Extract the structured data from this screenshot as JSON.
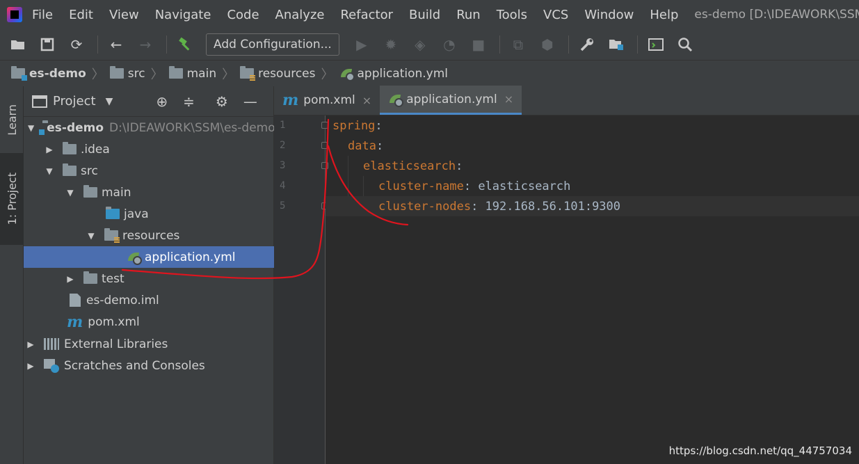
{
  "menu": {
    "items": [
      "File",
      "Edit",
      "View",
      "Navigate",
      "Code",
      "Analyze",
      "Refactor",
      "Build",
      "Run",
      "Tools",
      "VCS",
      "Window",
      "Help"
    ],
    "window_title": "es-demo [D:\\IDEAWORK\\SSM\\es-demo]"
  },
  "toolbar": {
    "config_label": "Add Configuration..."
  },
  "breadcrumb": [
    "es-demo",
    "src",
    "main",
    "resources",
    "application.yml"
  ],
  "toolstrip": {
    "learn": "Learn",
    "project": "1: Project"
  },
  "project_panel": {
    "title": "Project",
    "tree": [
      {
        "label": "es-demo",
        "hint": "D:\\IDEAWORK\\SSM\\es-demo"
      },
      {
        "label": ".idea"
      },
      {
        "label": "src"
      },
      {
        "label": "main"
      },
      {
        "label": "java"
      },
      {
        "label": "resources"
      },
      {
        "label": "application.yml"
      },
      {
        "label": "test"
      },
      {
        "label": "es-demo.iml"
      },
      {
        "label": "pom.xml"
      },
      {
        "label": "External Libraries"
      },
      {
        "label": "Scratches and Consoles"
      }
    ]
  },
  "editor": {
    "tabs": [
      {
        "label": "pom.xml",
        "close": "×"
      },
      {
        "label": "application.yml",
        "close": "×"
      }
    ],
    "lines": [
      {
        "num": "1",
        "key": "spring",
        "sep": ":",
        "value": ""
      },
      {
        "num": "2",
        "key": "data",
        "sep": ":",
        "value": ""
      },
      {
        "num": "3",
        "key": "elasticsearch",
        "sep": ":",
        "value": ""
      },
      {
        "num": "4",
        "key": "cluster-name",
        "sep": ": ",
        "value": "elasticsearch"
      },
      {
        "num": "5",
        "key": "cluster-nodes",
        "sep": ": ",
        "value": "192.168.56.101:9300"
      }
    ]
  },
  "watermark": "https://blog.csdn.net/qq_44757034",
  "colors": {
    "yaml_key": "#cc7832",
    "annotation": "#e0141e",
    "selection": "#4b6eaf"
  }
}
